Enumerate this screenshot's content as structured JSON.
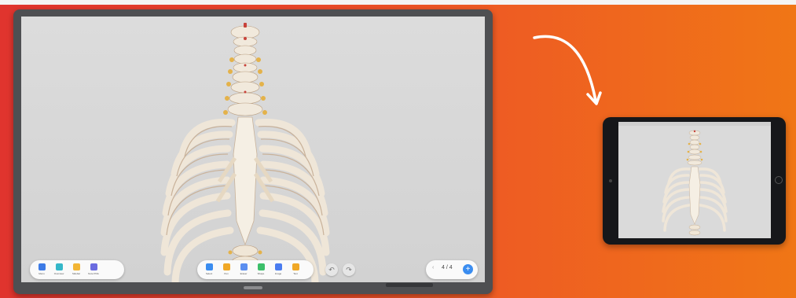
{
  "left_toolbar": {
    "items": [
      {
        "label": "Menu",
        "icon": "menu-icon",
        "color": "#3d7be6"
      },
      {
        "label": "Overview",
        "icon": "monitor-icon",
        "color": "#35b7c9"
      },
      {
        "label": "Sidebar",
        "icon": "folder-icon",
        "color": "#f2b534"
      },
      {
        "label": "Note PNG",
        "icon": "document-icon",
        "color": "#6a6be0"
      }
    ]
  },
  "center_toolbar": {
    "items": [
      {
        "label": "Select",
        "icon": "cursor-icon",
        "color": "#3b8df0"
      },
      {
        "label": "Pen",
        "icon": "pen-icon",
        "color": "#f0a826"
      },
      {
        "label": "Eraser",
        "icon": "eraser-icon",
        "color": "#5a8ef0"
      },
      {
        "label": "Shape",
        "icon": "pin-icon",
        "color": "#3cbf6a"
      },
      {
        "label": "Image",
        "icon": "layers-icon",
        "color": "#4a7cf0"
      },
      {
        "label": "Text",
        "icon": "toolbox-icon",
        "color": "#f0a826"
      }
    ]
  },
  "history": {
    "undo_icon": "undo-icon",
    "redo_icon": "redo-icon"
  },
  "pager": {
    "current": "4 / 4",
    "prev_glyph": "‹",
    "add_glyph": "+"
  },
  "colors": {
    "accent": "#3b8df0",
    "background_start": "#e0342e",
    "background_end": "#f07616"
  }
}
